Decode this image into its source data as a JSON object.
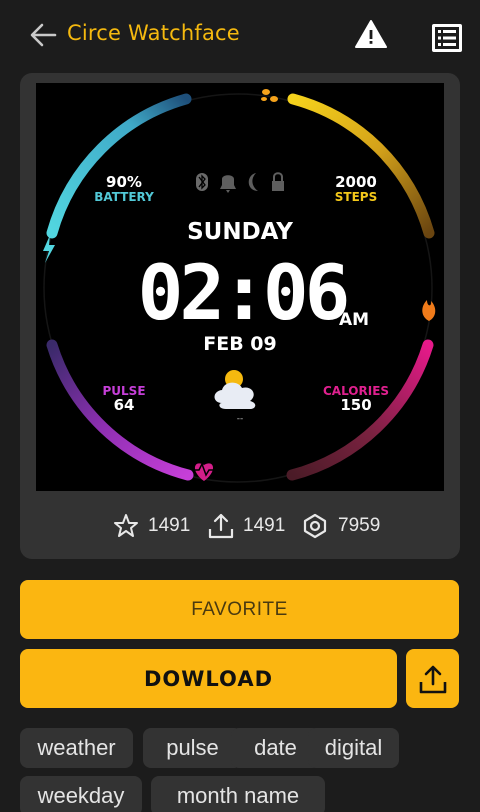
{
  "header": {
    "title": "Circe Watchface",
    "back_icon": "arrow-left-icon",
    "warning_icon": "warning-icon",
    "list_icon": "list-icon"
  },
  "watchface": {
    "battery_value": "90%",
    "battery_label": "BATTERY",
    "steps_value": "2000",
    "steps_label": "STEPS",
    "day": "SUNDAY",
    "time": "02:06",
    "ampm": "AM",
    "date": "FEB 09",
    "pulse_label": "PULSE",
    "pulse_value": "64",
    "calories_label": "CALORIES",
    "calories_value": "150",
    "weather_text": "--",
    "colors": {
      "battery": "#52c8d6",
      "steps": "#f3c81a",
      "pulse": "#b23cc8",
      "calories": "#e0208f"
    }
  },
  "stats": {
    "favorites": "1491",
    "shares": "1491",
    "views": "7959"
  },
  "buttons": {
    "favorite": "FAVORITE",
    "download": "DOWLOAD"
  },
  "tags": [
    "weather",
    "pulse",
    "date",
    "digital",
    "weekday",
    "month name"
  ],
  "accent": "#fbb611"
}
